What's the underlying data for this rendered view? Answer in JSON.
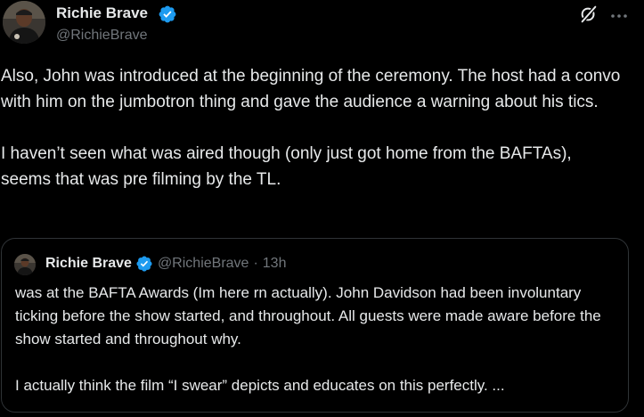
{
  "author": {
    "name": "Richie Brave",
    "handle": "@RichieBrave"
  },
  "tweet": {
    "paragraphs": [
      "Also, John was introduced at the beginning of the ceremony. The host had a convo with him on the jumbotron thing and gave the audience a warning about his tics.",
      "I haven’t seen what was aired though (only just got home from the BAFTAs), seems that was pre filming by the TL."
    ]
  },
  "quoted": {
    "name": "Richie Brave",
    "handle": "@RichieBrave",
    "separator": "·",
    "time": "13h",
    "paragraphs": [
      "was at the BAFTA Awards (Im here rn actually). John Davidson had been involuntary ticking before the show started, and throughout. All guests were made aware before the show started and throughout why.",
      "I actually think the film “I swear” depicts and educates on this perfectly. ..."
    ]
  },
  "icons": {
    "verified": "verified-badge-icon",
    "grok": "grok-icon",
    "more": "more-options-icon"
  },
  "colors": {
    "background": "#000000",
    "text_primary": "#e7e9ea",
    "text_secondary": "#71767b",
    "verified_blue": "#1d9bf0",
    "border": "#2f3336"
  }
}
